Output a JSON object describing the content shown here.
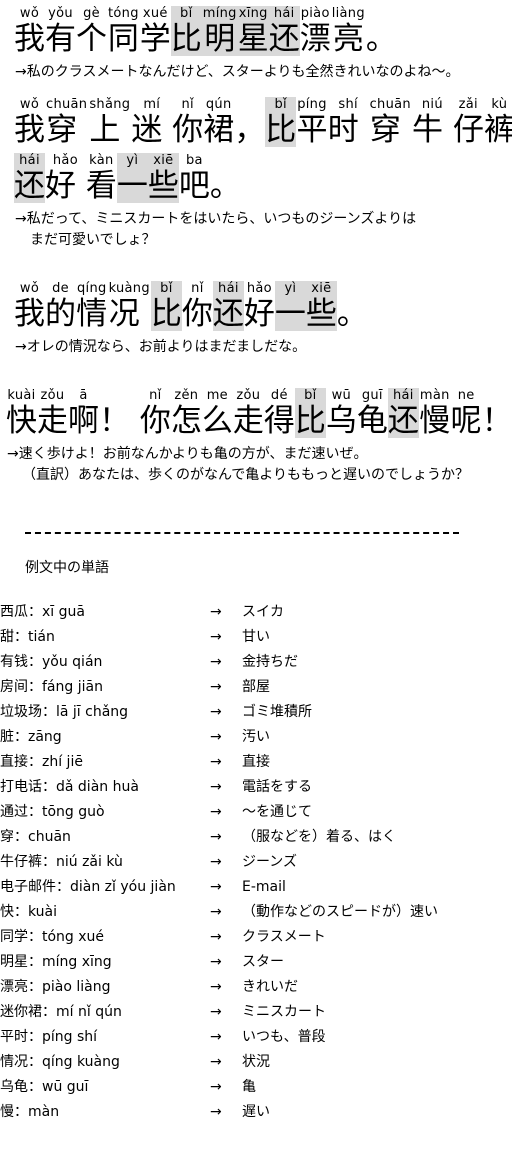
{
  "document": {
    "type": "chinese-grammar-lesson-page",
    "language_pair": "zh-ja"
  },
  "examples": [
    {
      "id": "example-1",
      "units": [
        {
          "py": "wǒ",
          "hz": "我",
          "hl": false
        },
        {
          "py": "yǒu",
          "hz": "有",
          "hl": false
        },
        {
          "py": "gè",
          "hz": "个",
          "hl": false
        },
        {
          "py": "tóng",
          "hz": "同",
          "hl": false
        },
        {
          "py": "xué",
          "hz": "学",
          "hl": false
        },
        {
          "py": "bǐ",
          "hz": "比",
          "hl": true
        },
        {
          "py": "míng",
          "hz": "明",
          "hl": true
        },
        {
          "py": "xīng",
          "hz": "星",
          "hl": true
        },
        {
          "py": "hái",
          "hz": "还",
          "hl": true
        },
        {
          "py": "piào",
          "hz": "漂",
          "hl": false
        },
        {
          "py": "liàng",
          "hz": "亮",
          "hl": false
        },
        {
          "py": "",
          "hz": "。",
          "hl": false
        }
      ],
      "translations": [
        {
          "text": "→私のクラスメートなんだけど、スターよりも全然きれいなのよね～。",
          "indent": false
        }
      ]
    },
    {
      "id": "example-2",
      "units": [
        {
          "py": "wǒ",
          "hz": "我",
          "hl": false
        },
        {
          "py": "chuān",
          "hz": "穿 ",
          "hl": false
        },
        {
          "py": "shǎng",
          "hz": "上 ",
          "hl": false
        },
        {
          "py": "mí",
          "hz": "迷 ",
          "hl": false
        },
        {
          "py": "nǐ",
          "hz": "你",
          "hl": false
        },
        {
          "py": "qún",
          "hz": "裙",
          "hl": false
        },
        {
          "py": "",
          "hz": "，",
          "hl": false
        },
        {
          "py": "bǐ",
          "hz": "比",
          "hl": true
        },
        {
          "py": "píng",
          "hz": "平",
          "hl": false
        },
        {
          "py": "shí",
          "hz": "时 ",
          "hl": false
        },
        {
          "py": "chuān",
          "hz": "穿 ",
          "hl": false
        },
        {
          "py": "niú",
          "hz": "牛 ",
          "hl": false
        },
        {
          "py": "zǎi",
          "hz": "仔",
          "hl": false
        },
        {
          "py": "kù",
          "hz": "裤",
          "hl": false
        }
      ],
      "units_line2": [
        {
          "py": "hái",
          "hz": "还",
          "hl": true
        },
        {
          "py": "hǎo",
          "hz": "好 ",
          "hl": false
        },
        {
          "py": "kàn",
          "hz": "看",
          "hl": false
        },
        {
          "py": "yì",
          "hz": "一",
          "hl": true
        },
        {
          "py": "xiē",
          "hz": "些",
          "hl": true
        },
        {
          "py": "ba",
          "hz": "吧",
          "hl": false
        },
        {
          "py": "",
          "hz": "。",
          "hl": false
        }
      ],
      "translations": [
        {
          "text": "→私だって、ミニスカートをはいたら、いつものジーンズよりは",
          "indent": false
        },
        {
          "text": "まだ可愛いでしょ？",
          "indent": true
        }
      ]
    },
    {
      "id": "example-3",
      "units": [
        {
          "py": "wǒ",
          "hz": "我",
          "hl": false
        },
        {
          "py": "de",
          "hz": "的",
          "hl": false
        },
        {
          "py": "qíng",
          "hz": "情",
          "hl": false
        },
        {
          "py": "kuàng",
          "hz": "况 ",
          "hl": false
        },
        {
          "py": "bǐ",
          "hz": "比",
          "hl": true
        },
        {
          "py": "nǐ",
          "hz": "你",
          "hl": false
        },
        {
          "py": "hái",
          "hz": "还",
          "hl": true
        },
        {
          "py": "hǎo",
          "hz": "好",
          "hl": false
        },
        {
          "py": "yì",
          "hz": "一",
          "hl": true
        },
        {
          "py": "xiē",
          "hz": "些",
          "hl": true
        },
        {
          "py": "",
          "hz": "。",
          "hl": false
        }
      ],
      "translations": [
        {
          "text": "→オレの情況なら、お前よりはまだましだな。",
          "indent": false
        }
      ]
    },
    {
      "id": "example-4",
      "units": [
        {
          "py": "kuài",
          "hz": "快",
          "hl": false
        },
        {
          "py": "zǒu",
          "hz": "走",
          "hl": false
        },
        {
          "py": "ā",
          "hz": "啊",
          "hl": false
        },
        {
          "py": "",
          "hz": "！ ",
          "hl": false
        },
        {
          "py": "nǐ",
          "hz": "你",
          "hl": false
        },
        {
          "py": "zěn",
          "hz": "怎",
          "hl": false
        },
        {
          "py": "me",
          "hz": "么",
          "hl": false
        },
        {
          "py": "zǒu",
          "hz": "走",
          "hl": false
        },
        {
          "py": "dé",
          "hz": "得",
          "hl": false
        },
        {
          "py": "bǐ",
          "hz": "比",
          "hl": true
        },
        {
          "py": "wū",
          "hz": "乌",
          "hl": false
        },
        {
          "py": "guī",
          "hz": "龟",
          "hl": false
        },
        {
          "py": "hái",
          "hz": "还",
          "hl": true
        },
        {
          "py": "màn",
          "hz": "慢",
          "hl": false
        },
        {
          "py": "ne",
          "hz": "呢",
          "hl": false
        },
        {
          "py": "",
          "hz": "！",
          "hl": false
        }
      ],
      "translations": [
        {
          "text": "→速く歩けよ！お前なんかよりも亀の方が、まだ速いぜ。",
          "indent": false
        },
        {
          "text": "（直訳）あなたは、歩くのがなんで亀よりももっと遅いのでしょうか？",
          "indent": true
        }
      ]
    }
  ],
  "vocabulary": {
    "title": "例文中の単語",
    "arrow": "→",
    "rows": [
      {
        "term": "西瓜：xī guā",
        "jp": "スイカ"
      },
      {
        "term": "甜：tián",
        "jp": "甘い"
      },
      {
        "term": "有钱：yǒu qián",
        "jp": "金持ちだ"
      },
      {
        "term": "房间：fáng jiān",
        "jp": "部屋"
      },
      {
        "term": "垃圾场：lā jī chǎng",
        "jp": "ゴミ堆積所"
      },
      {
        "term": "脏：zāng",
        "jp": "汚い"
      },
      {
        "term": "直接：zhí jiē",
        "jp": "直接"
      },
      {
        "term": "打电话：dǎ diàn huà",
        "jp": "電話をする"
      },
      {
        "term": "通过：tōng guò",
        "jp": "～を通じて"
      },
      {
        "term": "穿：chuān",
        "jp": "（服などを）着る、はく"
      },
      {
        "term": "牛仔裤：niú zǎi kù",
        "jp": "ジーンズ"
      },
      {
        "term": "电子邮件：diàn zǐ yóu jiàn",
        "jp": "E-mail"
      },
      {
        "term": "快：kuài",
        "jp": "（動作などのスピードが）速い"
      },
      {
        "term": "同学：tóng xué",
        "jp": "クラスメート"
      },
      {
        "term": "明星：míng xīng",
        "jp": "スター"
      },
      {
        "term": "漂亮：piào liàng",
        "jp": "きれいだ"
      },
      {
        "term": "迷你裙：mí nǐ qún",
        "jp": "ミニスカート"
      },
      {
        "term": "平时：píng shí",
        "jp": "いつも、普段"
      },
      {
        "term": "情况：qíng kuàng",
        "jp": "状況"
      },
      {
        "term": "乌龟：wū guī",
        "jp": "亀"
      },
      {
        "term": "慢：màn",
        "jp": "遅い"
      }
    ]
  },
  "colors": {
    "highlight": "#d9d9d9",
    "text": "#000000",
    "background": "#ffffff"
  }
}
